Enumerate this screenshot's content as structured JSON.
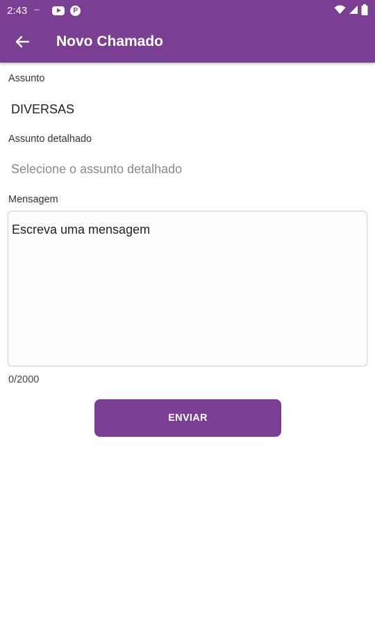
{
  "status_bar": {
    "time": "2:43",
    "icons": [
      "data-saver-icon",
      "youtube-icon",
      "p-app-icon",
      "wifi-icon",
      "signal-icon",
      "battery-icon"
    ],
    "p_icon_letter": "P"
  },
  "app_bar": {
    "title": "Novo Chamado",
    "back_icon": "arrow-left-icon",
    "color": "#7a3e92"
  },
  "form": {
    "subject": {
      "label": "Assunto",
      "value": "DIVERSAS"
    },
    "detailed_subject": {
      "label": "Assunto detalhado",
      "placeholder": "Selecione o assunto detalhado"
    },
    "message": {
      "label": "Mensagem",
      "placeholder": "Escreva uma mensagem",
      "counter": "0/2000"
    },
    "submit_label": "ENVIAR"
  }
}
